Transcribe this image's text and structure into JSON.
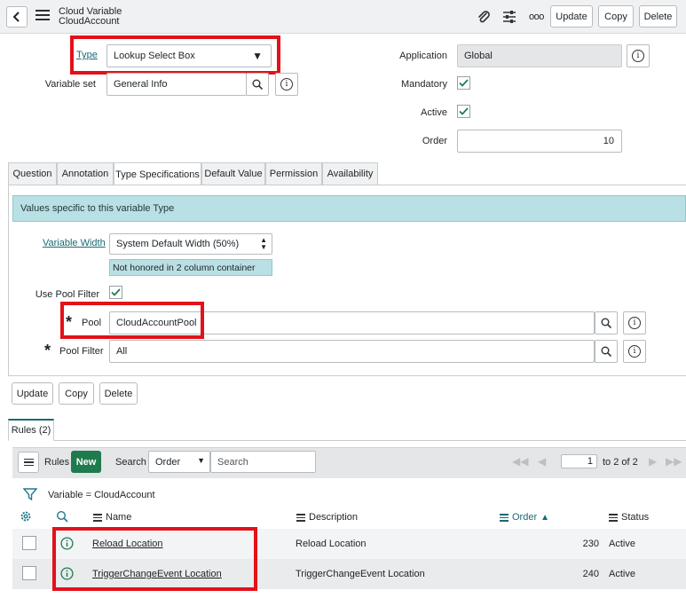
{
  "header": {
    "title_line1": "Cloud Variable",
    "title_line2": "CloudAccount",
    "update_label": "Update",
    "copy_label": "Copy",
    "delete_label": "Delete",
    "more_label": "ooo"
  },
  "form": {
    "type_label": "Type",
    "type_value": "Lookup Select Box",
    "variable_set_label": "Variable set",
    "variable_set_value": "General Info",
    "application_label": "Application",
    "application_value": "Global",
    "mandatory_label": "Mandatory",
    "active_label": "Active",
    "order_label": "Order",
    "order_value": "10"
  },
  "tabs": [
    "Question",
    "Annotation",
    "Type Specifications",
    "Default Value",
    "Permission",
    "Availability"
  ],
  "type_spec": {
    "banner": "Values specific to this variable Type",
    "variable_width_label": "Variable Width",
    "variable_width_value": "System Default Width (50%)",
    "width_note": "Not honored in 2 column container",
    "use_pool_filter_label": "Use Pool Filter",
    "pool_label": "Pool",
    "pool_value": "CloudAccountPool",
    "pool_filter_label": "Pool Filter",
    "pool_filter_value": "All"
  },
  "bottom_buttons": {
    "update": "Update",
    "copy": "Copy",
    "delete": "Delete"
  },
  "related": {
    "tab_label": "Rules (2)",
    "list_title": "Rules",
    "new_label": "New",
    "search_label": "Search",
    "search_field": "Order",
    "search_placeholder": "Search",
    "page_value": "1",
    "page_total": "to 2 of 2",
    "filter_text": "Variable = CloudAccount",
    "columns": {
      "name": "Name",
      "description": "Description",
      "order": "Order",
      "status": "Status"
    },
    "rows": [
      {
        "name": "Reload Location",
        "description": "Reload Location",
        "order": "230",
        "status": "Active"
      },
      {
        "name": "TriggerChangeEvent Location",
        "description": "TriggerChangeEvent Location",
        "order": "240",
        "status": "Active"
      }
    ]
  },
  "colors": {
    "highlight": "#e3111a",
    "new_button": "#1f7a4d",
    "banner": "#b9e0e4",
    "link": "#1a6a73"
  }
}
